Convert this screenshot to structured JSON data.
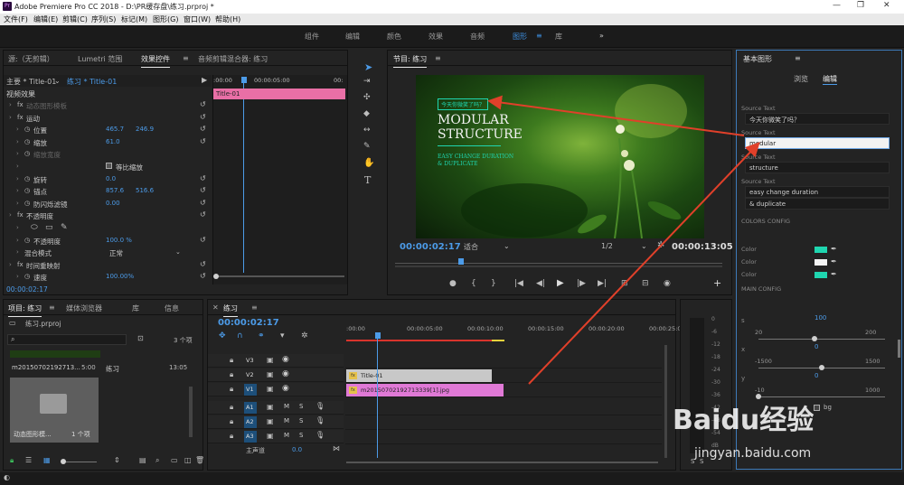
{
  "window": {
    "title": "Adobe Premiere Pro CC 2018 - D:\\PR缓存盘\\练习.prproj *",
    "minimize": "—",
    "maximize": "❐",
    "close": "✕"
  },
  "menu": [
    "文件(F)",
    "编辑(E)",
    "剪辑(C)",
    "序列(S)",
    "标记(M)",
    "图形(G)",
    "窗口(W)",
    "帮助(H)"
  ],
  "workspaces": {
    "items": [
      "组件",
      "编辑",
      "颜色",
      "效果",
      "音频",
      "图形",
      "库"
    ],
    "active": "图形",
    "more": "»"
  },
  "effect_controls": {
    "tabs": [
      "源:（无剪辑）",
      "Lumetri 范围",
      "效果控件",
      "音频剪辑混合器: 练习"
    ],
    "active_tab": "效果控件",
    "master": "主要 * Title-01",
    "clip": "练习 * Title-01",
    "section": "视频效果",
    "ruler": [
      ":00:00",
      "00:00:05:00",
      "00:"
    ],
    "clip_bar": "Title-01",
    "rows": [
      {
        "label": "动态图形模板",
        "indent": 1,
        "fx": true,
        "dim": true
      },
      {
        "label": "运动",
        "indent": 1,
        "fx": true
      },
      {
        "label": "位置",
        "indent": 2,
        "v1": "465.7",
        "v2": "246.9"
      },
      {
        "label": "缩放",
        "indent": 2,
        "v1": "61.0"
      },
      {
        "label": "缩放宽度",
        "indent": 2,
        "dim": true
      },
      {
        "label": "等比缩放",
        "indent": 2,
        "check": true
      },
      {
        "label": "旋转",
        "indent": 2,
        "v1": "0.0"
      },
      {
        "label": "锚点",
        "indent": 2,
        "v1": "857.6",
        "v2": "516.6"
      },
      {
        "label": "防闪烁滤镜",
        "indent": 2,
        "v1": "0.00"
      },
      {
        "label": "不透明度",
        "indent": 1,
        "fx": true
      },
      {
        "label": "shapes",
        "indent": 2,
        "shapes": true
      },
      {
        "label": "不透明度",
        "indent": 2,
        "v1": "100.0 %"
      },
      {
        "label": "混合模式",
        "indent": 2,
        "sel": "正常"
      },
      {
        "label": "时间重映射",
        "indent": 1,
        "fx": true
      },
      {
        "label": "速度",
        "indent": 2,
        "v1": "100.00%"
      }
    ],
    "timecode": "00:00:02:17"
  },
  "program": {
    "title": "节目: 练习",
    "overlay": {
      "badge": "今天你微笑了吗？",
      "line1": "MODULAR",
      "line2": "STRUCTURE",
      "line3": "EASY CHANGE DURATION",
      "line4": "& DUPLICATE"
    },
    "timecode": "00:00:02:17",
    "fit": "适合",
    "quality": "1/2",
    "duration": "00:00:13:05"
  },
  "essential_graphics": {
    "title": "基本图形",
    "tabs": [
      "浏览",
      "编辑"
    ],
    "active_tab": "编辑",
    "sources": [
      {
        "label": "Source Text",
        "value": "今天你微笑了吗？"
      },
      {
        "label": "Source Text",
        "value": "modular",
        "focused": true
      },
      {
        "label": "Source Text",
        "value": "structure"
      },
      {
        "label": "Source Text",
        "value": "easy change duration"
      },
      {
        "label": "",
        "value": "& duplicate"
      }
    ],
    "color_config": "COLORS CONFIG",
    "colors": [
      {
        "label": "Color",
        "hex": "#1fd6b0"
      },
      {
        "label": "Color",
        "hex": "#f4f4f4"
      },
      {
        "label": "Color",
        "hex": "#1fd6b0"
      }
    ],
    "main_config": "MAIN CONFIG",
    "sliders": [
      {
        "name": "s",
        "value": "100",
        "min": "20",
        "max": "200",
        "pos": 0.44
      },
      {
        "name": "x",
        "value": "0",
        "min": "-1500",
        "max": "1500",
        "pos": 0.5
      },
      {
        "name": "y",
        "value": "0",
        "min": "-10",
        "max": "1000",
        "pos": 0.0
      }
    ],
    "bg_label": "bg"
  },
  "project": {
    "tabs": [
      "项目: 练习",
      "媒体浏览器",
      "库",
      "信息"
    ],
    "active_tab": "项目: 练习",
    "file": "练习.prproj",
    "count": "3 个项",
    "items": [
      {
        "name": "m20150702192713...",
        "duration": "5:00"
      },
      {
        "name": "练习",
        "duration": "13:05"
      },
      {
        "name": "动态图形模...",
        "duration": "1 个项"
      }
    ]
  },
  "timeline": {
    "title": "练习",
    "timecode": "00:00:02:17",
    "ruler": [
      ":00:00",
      "00:00:05:00",
      "00:00:10:00",
      "00:00:15:00",
      "00:00:20:00",
      "00:00:25:00"
    ],
    "tracks": [
      "V3",
      "V2",
      "V1",
      "A1",
      "A2",
      "A3"
    ],
    "master": {
      "label": "主声道",
      "value": "0.0"
    },
    "clips": [
      {
        "label": "Title-01",
        "track": "V2",
        "start": 0,
        "end": 6.0,
        "color": "#c8c8c8"
      },
      {
        "label": "m20150702192713339[1].jpg",
        "track": "V1",
        "start": 0,
        "end": 6.5,
        "color": "#e079d6"
      }
    ]
  },
  "meters": {
    "ticks": [
      "0",
      "-6",
      "-12",
      "-18",
      "-24",
      "-30",
      "-36",
      "-42",
      "-48",
      "-54",
      "dB"
    ],
    "s_labels": [
      "S",
      "S"
    ]
  },
  "watermark": {
    "brand": "Baidu经验",
    "url": "jingyan.baidu.com"
  },
  "arrows": {
    "color": "#e0402a"
  }
}
